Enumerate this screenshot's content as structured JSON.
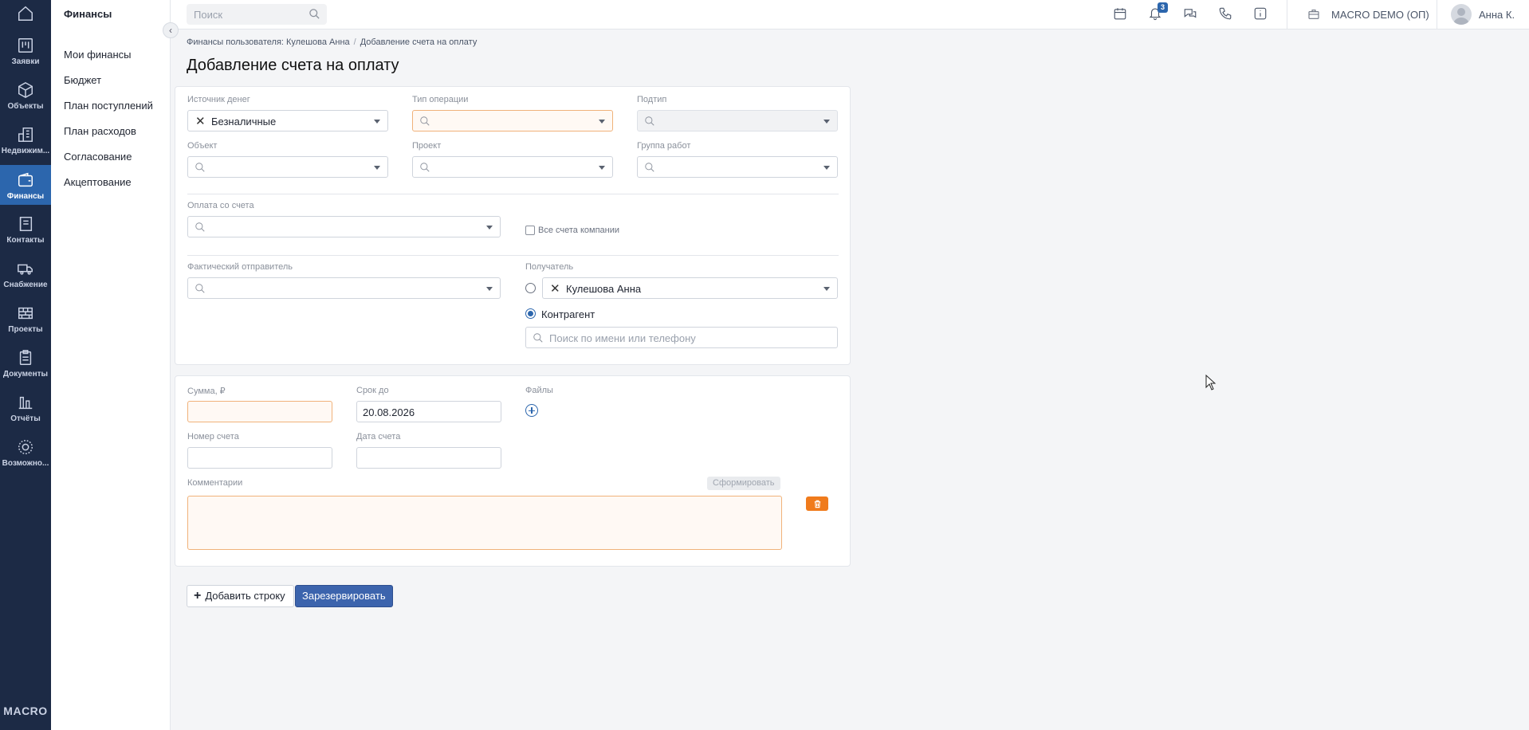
{
  "rail": {
    "items": [
      {
        "label": "",
        "icon": "home-icon"
      },
      {
        "label": "Заявки",
        "icon": "kanban-icon"
      },
      {
        "label": "Объекты",
        "icon": "cube-icon"
      },
      {
        "label": "Недвижим...",
        "icon": "building-icon"
      },
      {
        "label": "Финансы",
        "icon": "wallet-icon",
        "active": true
      },
      {
        "label": "Контакты",
        "icon": "contacts-book-icon"
      },
      {
        "label": "Снабжение",
        "icon": "truck-icon"
      },
      {
        "label": "Проекты",
        "icon": "brick-wall-icon"
      },
      {
        "label": "Документы",
        "icon": "clipboard-icon"
      },
      {
        "label": "Отчёты",
        "icon": "bar-chart-icon"
      },
      {
        "label": "Возможно...",
        "icon": "gear-circle-icon"
      }
    ],
    "logo": "MACRO"
  },
  "subnav": {
    "title": "Финансы",
    "items": [
      "Мои финансы",
      "Бюджет",
      "План поступлений",
      "План расходов",
      "Согласование",
      "Акцептование"
    ]
  },
  "topbar": {
    "search_placeholder": "Поиск",
    "notification_count": "3",
    "company": "MACRO DEMO (ОП)",
    "user": "Анна К."
  },
  "breadcrumb": {
    "parent": "Финансы пользователя: Кулешова Анна",
    "separator": "/",
    "current": "Добавление счета на оплату"
  },
  "page_title": "Добавление счета на оплату",
  "form": {
    "source_label": "Источник денег",
    "source_value": "Безналичные",
    "op_type_label": "Тип операции",
    "subtype_label": "Подтип",
    "object_label": "Объект",
    "project_label": "Проект",
    "workgroup_label": "Группа работ",
    "pay_from_label": "Оплата со счета",
    "all_accounts_label": "Все счета компании",
    "sender_label": "Фактический отправитель",
    "recipient_label": "Получатель",
    "recipient_person_value": "Кулешова Анна",
    "counterparty_label": "Контрагент",
    "counterparty_placeholder": "Поиск по имени или телефону"
  },
  "invoice": {
    "sum_label": "Сумма, ₽",
    "sum_value": "",
    "due_label": "Срок до",
    "due_value": "20.08.2026",
    "files_label": "Файлы",
    "number_label": "Номер счета",
    "date_label": "Дата счета",
    "comments_label": "Комментарии",
    "generate_label": "Сформировать"
  },
  "actions": {
    "add_row_label": "Добавить строку",
    "reserve_label": "Зарезервировать"
  },
  "colors": {
    "rail_bg": "#1c2a45",
    "rail_active": "#2c66ad",
    "primary_button": "#3c64ad",
    "warning_border": "#f0b27a",
    "delete_button": "#f07b1c"
  }
}
